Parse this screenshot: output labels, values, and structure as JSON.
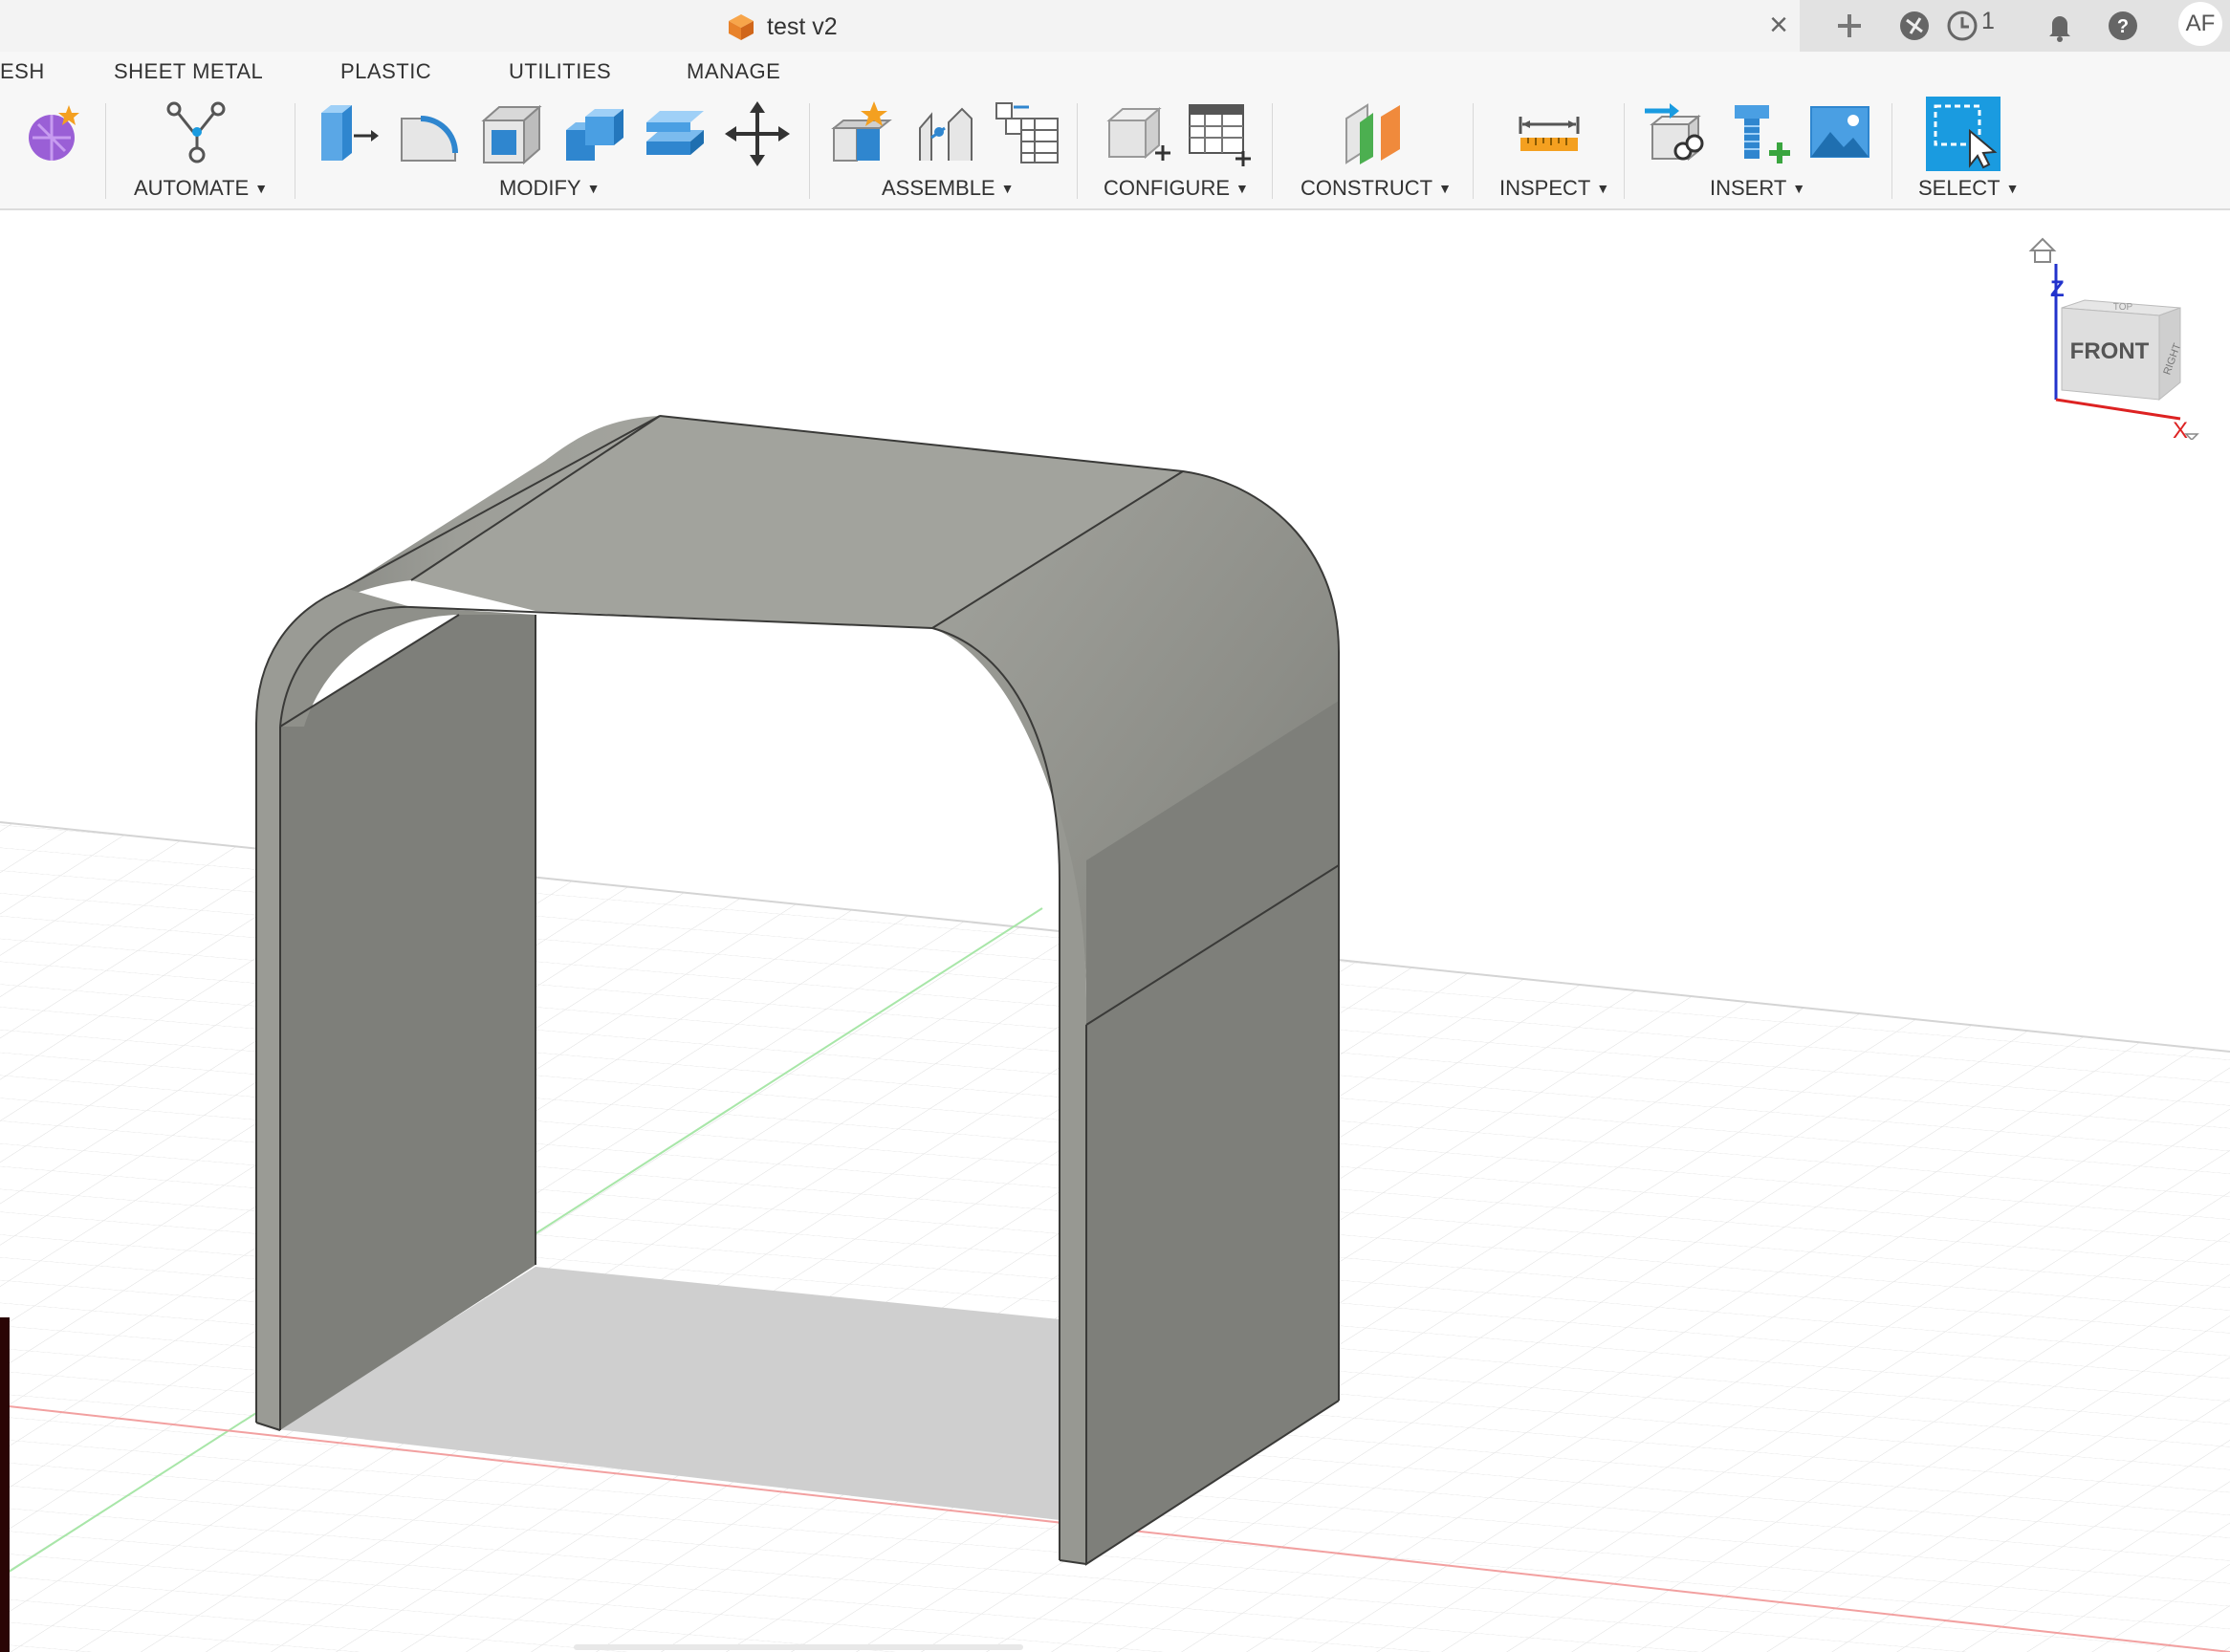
{
  "document": {
    "title": "test v2"
  },
  "header": {
    "job_count": "1",
    "user_initials": "AF"
  },
  "workspace_tabs": [
    "ESH",
    "SHEET METAL",
    "PLASTIC",
    "UTILITIES",
    "MANAGE"
  ],
  "toolbar": {
    "automate": "AUTOMATE",
    "modify": "MODIFY",
    "assemble": "ASSEMBLE",
    "configure": "CONFIGURE",
    "construct": "CONSTRUCT",
    "inspect": "INSPECT",
    "insert": "INSERT",
    "select": "SELECT"
  },
  "viewcube": {
    "front": "FRONT",
    "right": "RIGHT",
    "top": "TOP",
    "axis_z": "Z",
    "axis_x": "X"
  },
  "colors": {
    "accent": "#1a9be0",
    "body_face": "#8b8c86",
    "top_face": "#a2a39d",
    "grid": "#e4e4e4"
  }
}
